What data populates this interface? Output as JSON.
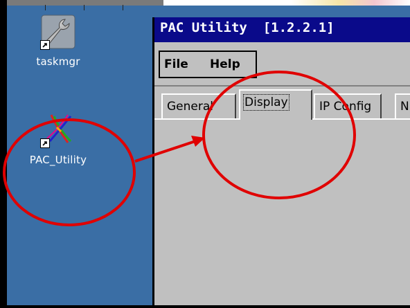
{
  "desktop": {
    "icons": [
      {
        "label": "taskmgr",
        "icon": "wrench-icon"
      },
      {
        "label": "PAC_Utility",
        "icon": "pac-utility-icon"
      }
    ]
  },
  "window": {
    "title": "PAC Utility  [1.2.2.1]",
    "menu": [
      {
        "label": "File"
      },
      {
        "label": "Help"
      }
    ],
    "tabs": [
      {
        "label": "General",
        "active": false
      },
      {
        "label": "Display",
        "active": true
      },
      {
        "label": "IP Config",
        "active": false
      },
      {
        "label": "N",
        "active": false
      }
    ]
  },
  "colors": {
    "desktop": "#3a6ea5",
    "titlebar": "#0a0a8a",
    "annotation": "#e00000"
  }
}
